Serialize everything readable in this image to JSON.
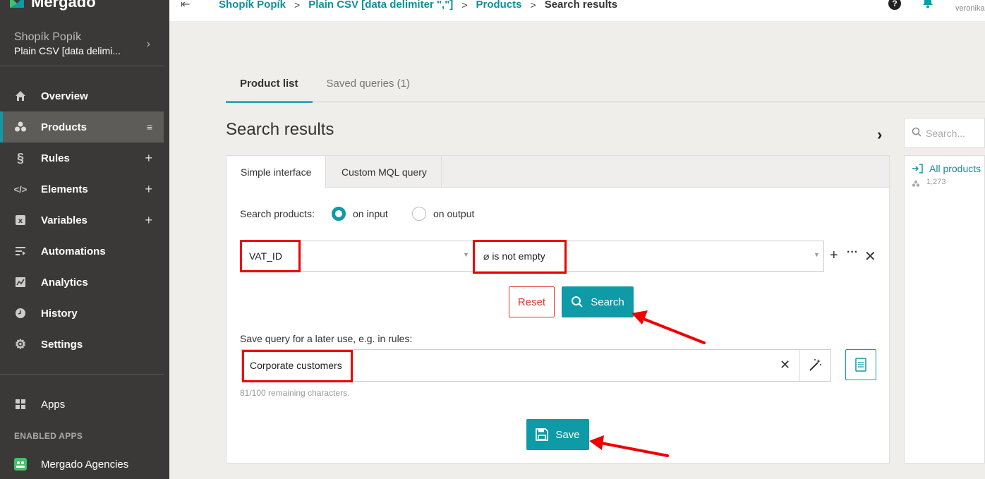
{
  "app": {
    "brand": "Mergado"
  },
  "project": {
    "name": "Shopík Popík",
    "subtitle": "Plain CSV [data delimi..."
  },
  "sidebar": {
    "items": [
      {
        "label": "Overview",
        "icon": "home-icon"
      },
      {
        "label": "Products",
        "icon": "products-icon",
        "right": "≡",
        "active": true
      },
      {
        "label": "Rules",
        "icon": "section-icon",
        "right": "+"
      },
      {
        "label": "Elements",
        "icon": "code-icon",
        "right": "+"
      },
      {
        "label": "Variables",
        "icon": "variable-icon",
        "right": "+"
      },
      {
        "label": "Automations",
        "icon": "automation-icon"
      },
      {
        "label": "Analytics",
        "icon": "chart-icon"
      },
      {
        "label": "History",
        "icon": "clock-icon"
      },
      {
        "label": "Settings",
        "icon": "gear-icon"
      }
    ],
    "apps_label": "Apps",
    "enabled_apps_heading": "ENABLED APPS",
    "enabled_apps": [
      "Mergado Agencies"
    ]
  },
  "breadcrumb": {
    "items": [
      "Shopík Popík",
      "Plain CSV [data delimiter \",\"]",
      "Products",
      "Search results"
    ],
    "separator": ">"
  },
  "topbar": {
    "help": "?",
    "user": "veronika"
  },
  "tabs": {
    "product_list": "Product list",
    "saved_queries": "Saved queries (1)"
  },
  "page": {
    "title": "Search results"
  },
  "card": {
    "tab_simple": "Simple interface",
    "tab_mql": "Custom MQL query",
    "search_products_label": "Search products:",
    "radio_input": "on input",
    "radio_output": "on output",
    "condition": {
      "field": "VAT_ID",
      "operator": "⌀ is not empty"
    },
    "reset_label": "Reset",
    "search_label": "Search",
    "save_query_label": "Save query for a later use, e.g. in rules:",
    "save_query_value": "Corporate customers",
    "remaining": "81/100 remaining characters.",
    "save_label": "Save"
  },
  "right_panel": {
    "search_placeholder": "Search...",
    "all_products": "All products",
    "count": "1,273"
  },
  "colors": {
    "accent": "#0e9aa7",
    "sidebar": "#3a3937",
    "highlight": "#e00000",
    "reset": "#d33333"
  }
}
